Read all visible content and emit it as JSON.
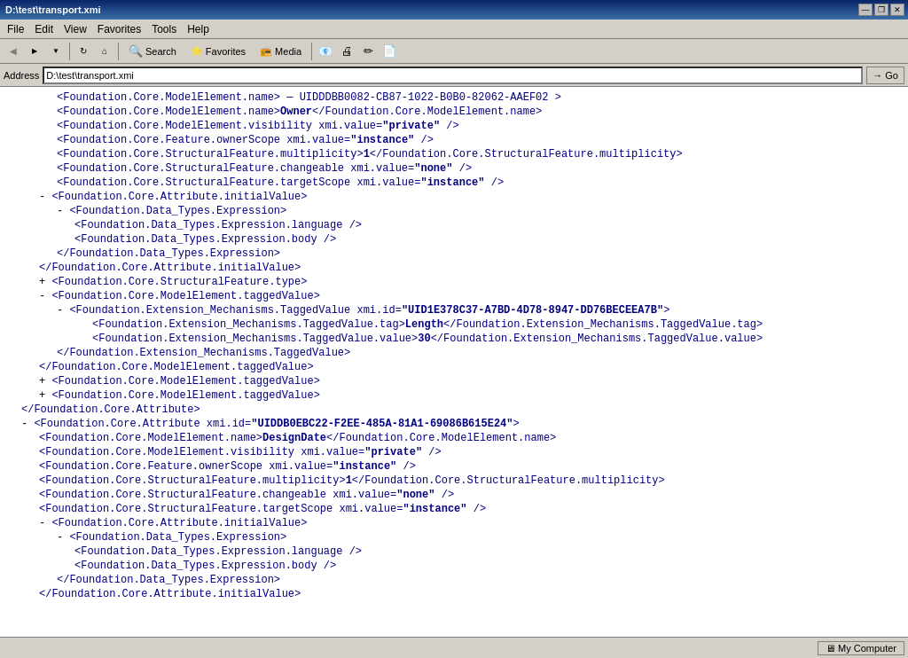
{
  "titleBar": {
    "title": "D:\\test\\transport.xmi",
    "minBtn": "—",
    "restoreBtn": "❐",
    "closeBtn": "✕"
  },
  "menuBar": {
    "items": [
      "File",
      "Edit",
      "View",
      "Favorites",
      "Tools",
      "Help"
    ]
  },
  "toolbar": {
    "backLabel": "Back",
    "forwardLabel": "→",
    "refreshIcon": "↻",
    "homeIcon": "⌂",
    "searchLabel": "Search",
    "favoritesLabel": "Favorites",
    "mediaLabel": "Media",
    "historyIcon": "↗",
    "goLabel": "Go"
  },
  "addressBar": {
    "label": "Address",
    "value": "D:\\test\\transport.xmi",
    "goLabel": "Go"
  },
  "xmlContent": [
    {
      "indent": 3,
      "type": "text",
      "text": "<Foundation.Core.ModelElement.name> — UIDDDBB0082-CB87-1022-B0B0-82062-AAEF02 >"
    },
    {
      "indent": 3,
      "type": "tag",
      "text": "<Foundation.Core.ModelElement.name>Owner</Foundation.Core.ModelElement.name>"
    },
    {
      "indent": 3,
      "type": "tag",
      "text": "<Foundation.Core.ModelElement.visibility xmi.value=\"private\" />"
    },
    {
      "indent": 3,
      "type": "tag",
      "text": "<Foundation.Core.Feature.ownerScope xmi.value=\"instance\" />"
    },
    {
      "indent": 3,
      "type": "tag",
      "text": "<Foundation.Core.StructuralFeature.multiplicity>1</Foundation.Core.StructuralFeature.multiplicity>"
    },
    {
      "indent": 3,
      "type": "tag",
      "text": "<Foundation.Core.StructuralFeature.changeable xmi.value=\"none\" />"
    },
    {
      "indent": 3,
      "type": "tag",
      "text": "<Foundation.Core.StructuralFeature.targetScope xmi.value=\"instance\" />"
    },
    {
      "indent": 2,
      "type": "collapse",
      "text": "- <Foundation.Core.Attribute.initialValue>"
    },
    {
      "indent": 3,
      "type": "collapse",
      "text": "- <Foundation.Data_Types.Expression>"
    },
    {
      "indent": 4,
      "type": "tag",
      "text": "<Foundation.Data_Types.Expression.language />"
    },
    {
      "indent": 4,
      "type": "tag",
      "text": "<Foundation.Data_Types.Expression.body />"
    },
    {
      "indent": 3,
      "type": "tag",
      "text": "</Foundation.Data_Types.Expression>"
    },
    {
      "indent": 2,
      "type": "tag",
      "text": "</Foundation.Core.Attribute.initialValue>"
    },
    {
      "indent": 2,
      "type": "expand",
      "text": "+ <Foundation.Core.StructuralFeature.type>"
    },
    {
      "indent": 2,
      "type": "collapse",
      "text": "- <Foundation.Core.ModelElement.taggedValue>"
    },
    {
      "indent": 3,
      "type": "collapse",
      "text": "- <Foundation.Extension_Mechanisms.TaggedValue xmi.id=\"UID1E378C37-A7BD-4D78-8947-DD76BECEEA7B\">"
    },
    {
      "indent": 5,
      "type": "tag",
      "text": "<Foundation.Extension_Mechanisms.TaggedValue.tag>Length</Foundation.Extension_Mechanisms.TaggedValue.tag>"
    },
    {
      "indent": 5,
      "type": "tag",
      "text": "<Foundation.Extension_Mechanisms.TaggedValue.value>30</Foundation.Extension_Mechanisms.TaggedValue.value>"
    },
    {
      "indent": 3,
      "type": "tag",
      "text": "</Foundation.Extension_Mechanisms.TaggedValue>"
    },
    {
      "indent": 2,
      "type": "tag",
      "text": "</Foundation.Core.ModelElement.taggedValue>"
    },
    {
      "indent": 2,
      "type": "expand",
      "text": "+ <Foundation.Core.ModelElement.taggedValue>"
    },
    {
      "indent": 2,
      "type": "expand",
      "text": "+ <Foundation.Core.ModelElement.taggedValue>"
    },
    {
      "indent": 1,
      "type": "tag",
      "text": "</Foundation.Core.Attribute>"
    },
    {
      "indent": 1,
      "type": "collapse",
      "text": "- <Foundation.Core.Attribute xmi.id=\"UIDDB0EBC22-F2EE-485A-81A1-69086B615E24\">"
    },
    {
      "indent": 2,
      "type": "tag",
      "text": "<Foundation.Core.ModelElement.name>DesignDate</Foundation.Core.ModelElement.name>"
    },
    {
      "indent": 2,
      "type": "tag",
      "text": "<Foundation.Core.ModelElement.visibility xmi.value=\"private\" />"
    },
    {
      "indent": 2,
      "type": "tag",
      "text": "<Foundation.Core.Feature.ownerScope xmi.value=\"instance\" />"
    },
    {
      "indent": 2,
      "type": "tag",
      "text": "<Foundation.Core.StructuralFeature.multiplicity>1</Foundation.Core.StructuralFeature.multiplicity>"
    },
    {
      "indent": 2,
      "type": "tag",
      "text": "<Foundation.Core.StructuralFeature.changeable xmi.value=\"none\" />"
    },
    {
      "indent": 2,
      "type": "tag",
      "text": "<Foundation.Core.StructuralFeature.targetScope xmi.value=\"instance\" />"
    },
    {
      "indent": 2,
      "type": "collapse",
      "text": "- <Foundation.Core.Attribute.initialValue>"
    },
    {
      "indent": 3,
      "type": "collapse",
      "text": "- <Foundation.Data_Types.Expression>"
    },
    {
      "indent": 4,
      "type": "tag",
      "text": "<Foundation.Data_Types.Expression.language />"
    },
    {
      "indent": 4,
      "type": "tag",
      "text": "<Foundation.Data_Types.Expression.body />"
    },
    {
      "indent": 3,
      "type": "tag",
      "text": "</Foundation.Data_Types.Expression>"
    },
    {
      "indent": 2,
      "type": "tag",
      "text": "</Foundation.Core.Attribute.initialValue>"
    }
  ],
  "statusBar": {
    "leftText": "",
    "computerLabel": "My Computer",
    "internetIcon": "🌐"
  }
}
